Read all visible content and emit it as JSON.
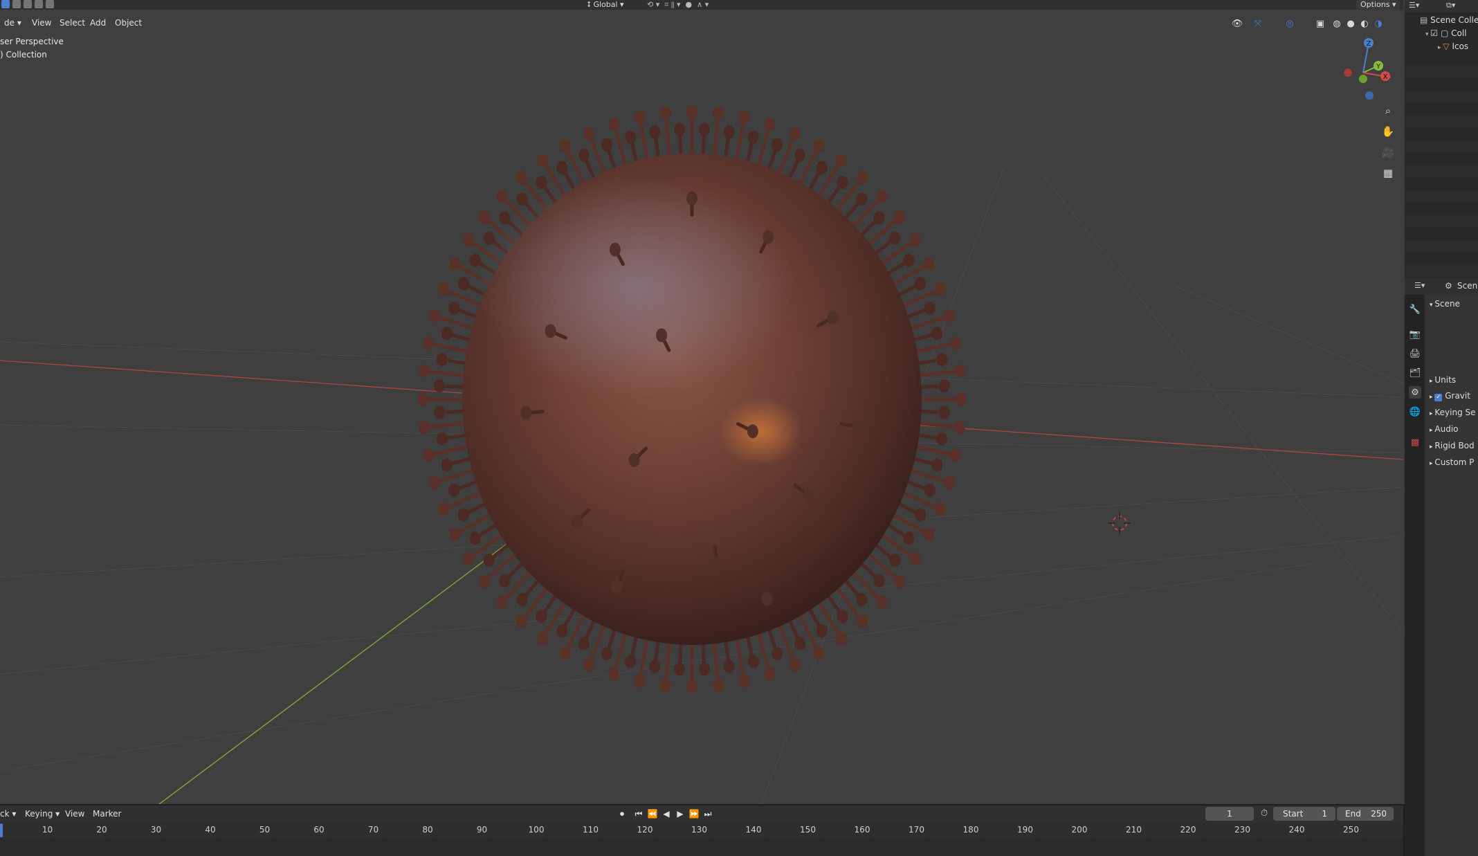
{
  "viewport_header": {
    "mode_label": "de",
    "menus": [
      "View",
      "Select",
      "Add",
      "Object"
    ],
    "orientation_label": "Global",
    "options_label": "Options"
  },
  "viewport_overlay": {
    "perspective_text": "ser Perspective",
    "collection_text": ") Collection"
  },
  "gizmo": {
    "z": "Z",
    "y": "Y",
    "x": "X"
  },
  "outliner": {
    "rows": [
      "Scene Colle",
      "Coll",
      "Icos"
    ]
  },
  "properties": {
    "header_label": "Scen",
    "panel_title": "Scene",
    "sections": [
      "Units",
      "Gravit",
      "Keying Se",
      "Audio",
      "Rigid Bod",
      "Custom P"
    ],
    "gravity_checked": true
  },
  "timeline": {
    "playback_label": "ck",
    "keying_label": "Keying",
    "view_label": "View",
    "marker_label": "Marker",
    "current_frame": "1",
    "start_label": "Start",
    "start_value": "1",
    "end_label": "End",
    "end_value": "250",
    "ticks": [
      "10",
      "20",
      "30",
      "40",
      "50",
      "60",
      "70",
      "80",
      "90",
      "100",
      "110",
      "120",
      "130",
      "140",
      "150",
      "160",
      "170",
      "180",
      "190",
      "200",
      "210",
      "220",
      "230",
      "240",
      "250"
    ]
  },
  "colors": {
    "x_axis": "#b04646",
    "y_axis": "#7ea33a",
    "virus_body": "#6e4036",
    "accent_blue": "#4a7fd1"
  }
}
